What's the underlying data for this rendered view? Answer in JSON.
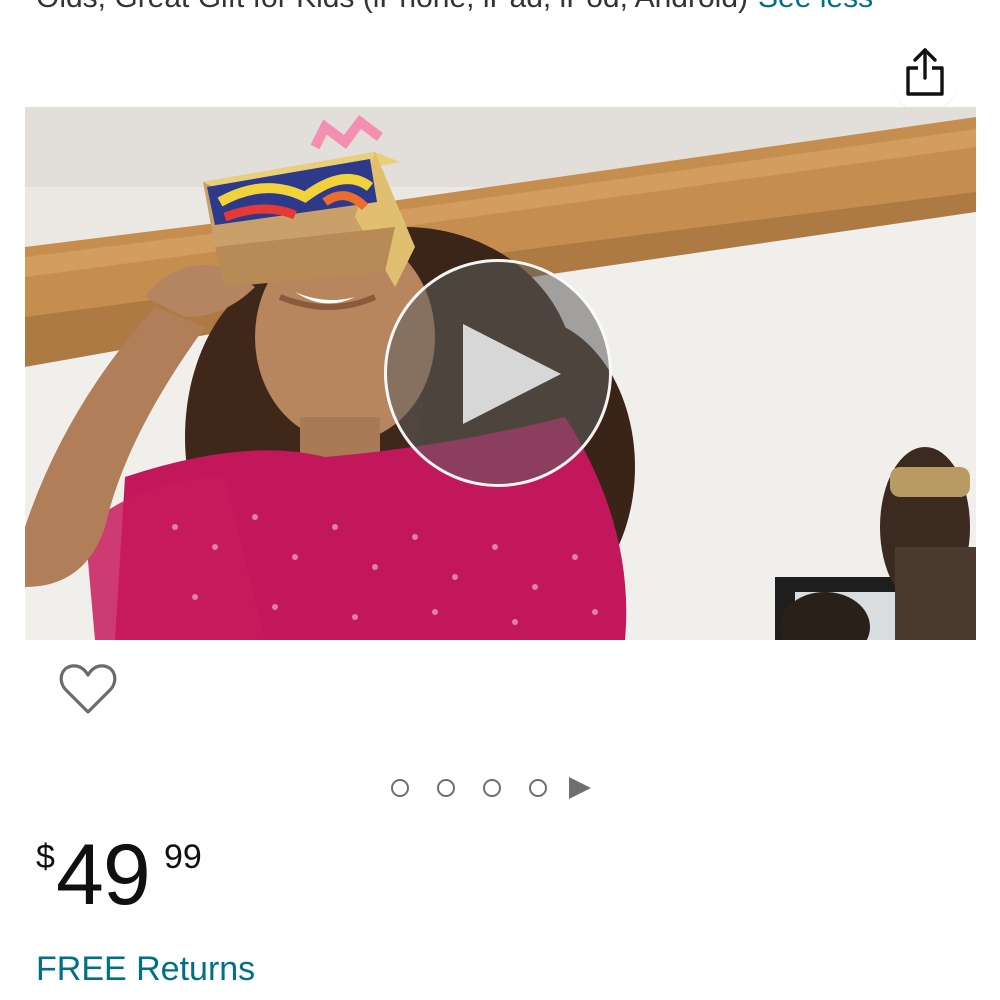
{
  "product": {
    "title_fragment": "Olds, Great Gift for Kids (iPhone, iPad, iPod, Android)",
    "see_less_label": "See less"
  },
  "share": {
    "icon": "share-icon"
  },
  "media": {
    "type": "video",
    "play_icon": "play-icon",
    "wishlist_icon": "heart-outline-icon",
    "carousel": {
      "dot_count": 4,
      "has_video_indicator": true,
      "video_indicator_icon": "play-triangle-icon"
    }
  },
  "price": {
    "symbol": "$",
    "whole": "49",
    "fraction": "99"
  },
  "returns": {
    "label": "FREE Returns"
  },
  "colors": {
    "link": "#007185",
    "text": "#0f1111"
  }
}
